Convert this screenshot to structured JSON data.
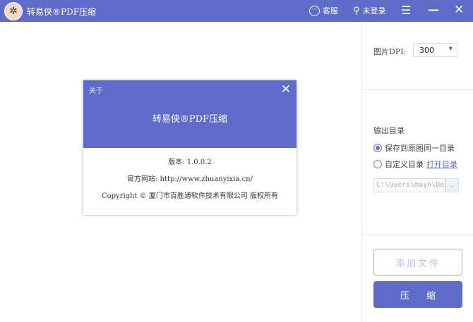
{
  "titlebar": {
    "app_title": "转易侠®PDF压缩",
    "support_label": "客服",
    "login_label": "未登录"
  },
  "panel": {
    "dpi_label": "图片DPI:",
    "dpi_value": "300",
    "output_label": "输出目录",
    "radio_same": "保存到原图同一目录",
    "radio_custom": "自定义目录",
    "open_dir_link": "打开目录",
    "path_value": "C:\\Users\\mayn\\Desk",
    "browse_label": "..",
    "add_file_label": "添加文件",
    "compress_label": "压 缩"
  },
  "dialog": {
    "title": "关于",
    "app_name": "转易侠®PDF压缩",
    "version": "版本: 1.0.0.2",
    "website": "官方网站: http://www.zhuanyixia.cn/",
    "copyright": "Copyright © 厦门市百胜通软件技术有限公司 版权所有"
  },
  "colors": {
    "accent": "#5f6bc8"
  }
}
